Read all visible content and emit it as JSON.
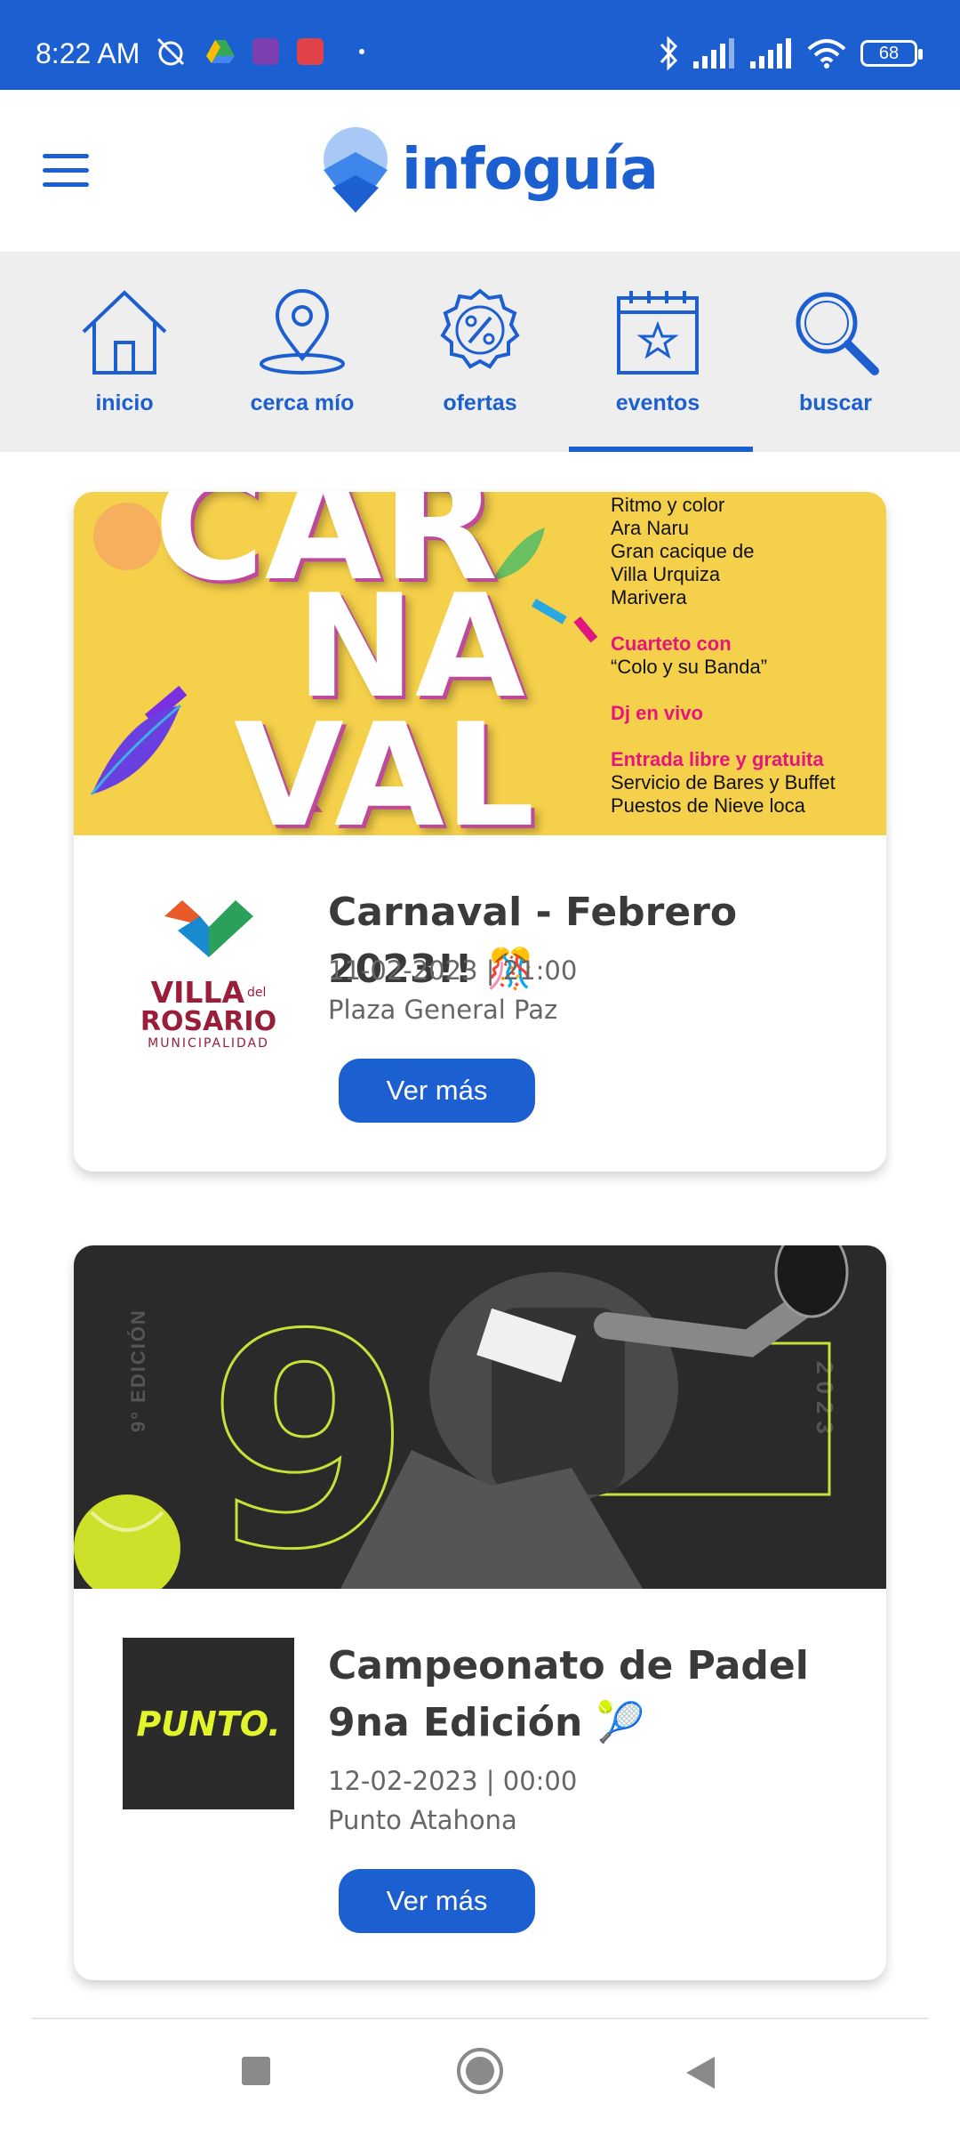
{
  "status_bar": {
    "time": "8:22 AM",
    "battery": "68",
    "colors": {
      "background": "#1c5fd1"
    }
  },
  "app": {
    "name": "infoguía",
    "brand_color": "#1c5fd1"
  },
  "tabs": [
    {
      "label": "inicio",
      "icon": "home-icon",
      "active": false
    },
    {
      "label": "cerca mío",
      "icon": "location-pin-icon",
      "active": false
    },
    {
      "label": "ofertas",
      "icon": "discount-badge-icon",
      "active": false
    },
    {
      "label": "eventos",
      "icon": "calendar-star-icon",
      "active": true
    },
    {
      "label": "buscar",
      "icon": "search-icon",
      "active": false
    }
  ],
  "events": [
    {
      "banner": {
        "word_lines": [
          "CAR",
          "NA",
          "VAL"
        ],
        "lines_1": [
          "Ritmo y color",
          "Ara Naru",
          "Gran cacique de",
          "Villa Urquiza",
          "Marivera"
        ],
        "highlight_1": "Cuarteto con",
        "line_2": "“Colo y su Banda”",
        "highlight_2": "Dj en vivo",
        "highlight_3": "Entrada libre y gratuita",
        "lines_3": [
          "Servicio de Bares y Buffet",
          "Puestos de Nieve loca"
        ]
      },
      "org_logo": {
        "line1": "VILLA",
        "small": "del",
        "line2": "ROSARIO",
        "line3": "MUNICIPALIDAD"
      },
      "title": "Carnaval - Febrero 2023!! 🎊",
      "datetime": "11-02-2023 | 21:00",
      "place": "Plaza General Paz",
      "button": "Ver más"
    },
    {
      "banner": {
        "big_number": "9",
        "edition_text": "9° EDICIÓN",
        "year_text": "2023"
      },
      "org_logo": {
        "text": "PUNTO."
      },
      "title": "Campeonato de Padel 9na Edición 🎾",
      "datetime": "12-02-2023 | 00:00",
      "place": "Punto Atahona",
      "button": "Ver más"
    }
  ],
  "nav": {
    "icons": [
      "recents-square-icon",
      "home-circle-icon",
      "back-triangle-icon"
    ]
  }
}
